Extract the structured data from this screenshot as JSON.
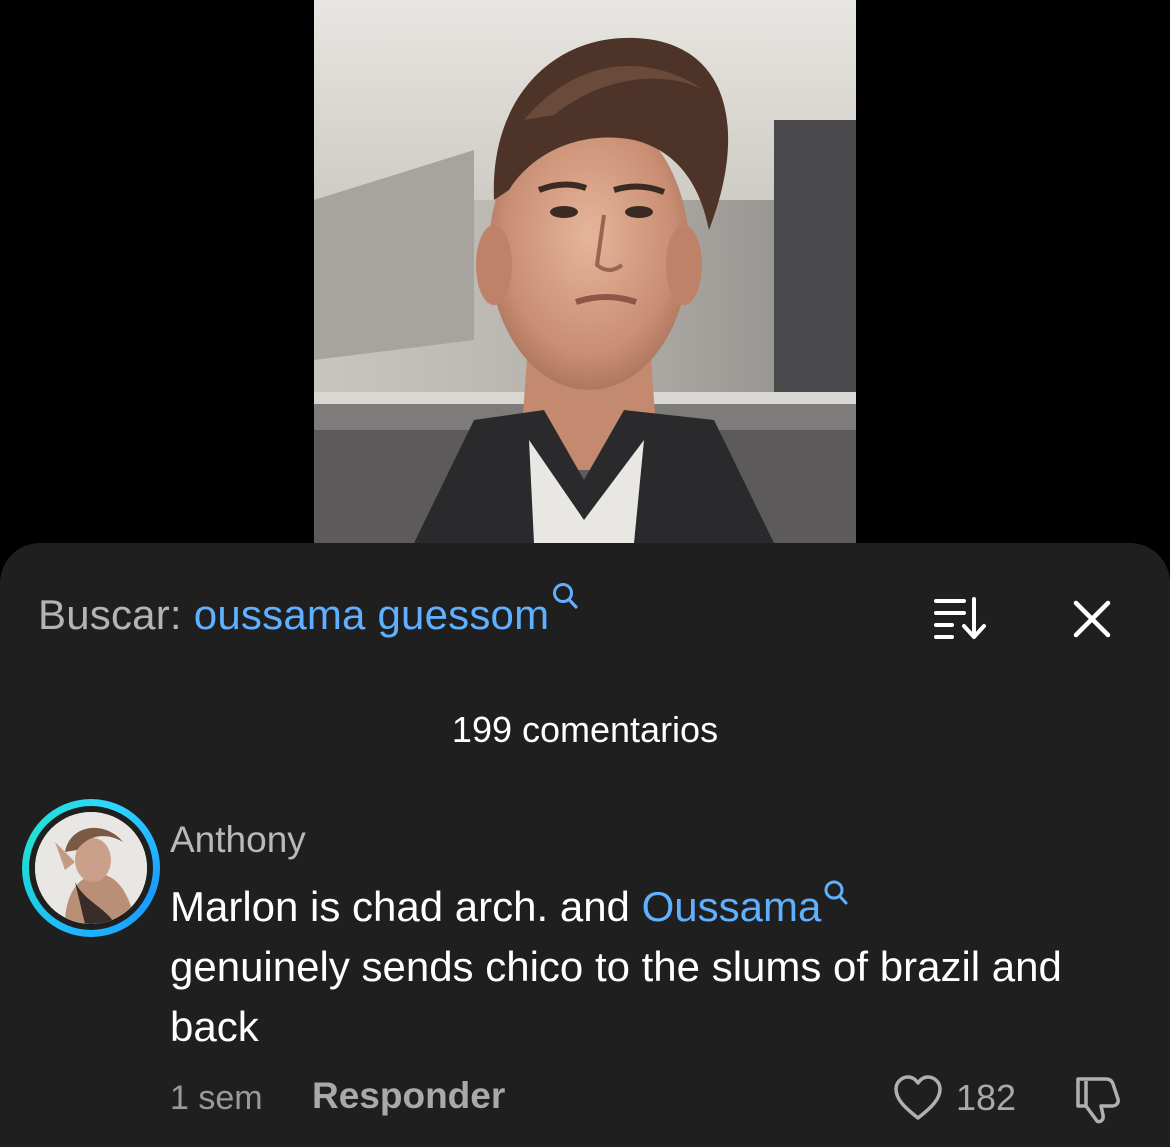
{
  "video": {
    "description_icon": "person-portrait-thumbnail"
  },
  "search": {
    "label": "Buscar:",
    "query": "oussama guessom",
    "query_icon": "search-icon"
  },
  "toolbar": {
    "sort_icon": "sort-icon",
    "close_icon": "close-icon"
  },
  "comments": {
    "count_label": "199 comentarios",
    "items": [
      {
        "username": "Anthony",
        "text_before": "Marlon is chad arch. and ",
        "mention": "Oussama",
        "text_after": "genuinely sends chico to the slums of brazil and back",
        "time": "1 sem",
        "reply_label": "Responder",
        "like_count": "182"
      }
    ]
  },
  "colors": {
    "sheet_bg": "#1f1f1f",
    "accent_blue": "#5fb0ff",
    "muted_text": "#b4b4b4",
    "avatar_ring": "#1db9ff"
  }
}
